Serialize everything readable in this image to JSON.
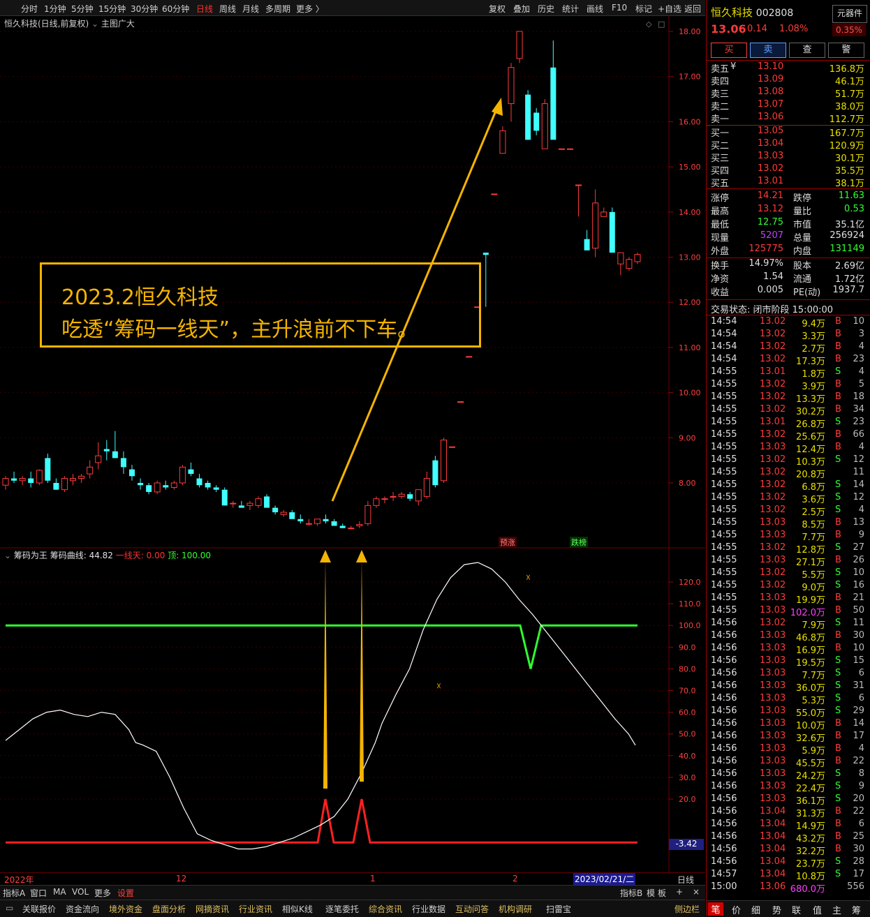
{
  "topbar": {
    "periods": [
      "分时",
      "1分钟",
      "5分钟",
      "15分钟",
      "30分钟",
      "60分钟",
      "日线",
      "周线",
      "月线",
      "多周期",
      "更多 〉"
    ],
    "active": "日线",
    "right_tools": [
      "复权",
      "叠加",
      "历史",
      "统计",
      "画线",
      "F10",
      "标记",
      "+自选",
      "返回"
    ]
  },
  "main_chart": {
    "title": "恒久科技(日线,前复权)",
    "indicator_name": "主图广大",
    "badges": [
      "预涨",
      "跌榜"
    ]
  },
  "annotation": {
    "line1": "2023.2恒久科技",
    "line2": "吃透“筹码一线天”，主升浪前不下车。"
  },
  "indicator": {
    "name": "筹码为王",
    "curve_label": "筹码曲线: 44.82",
    "line_label": "一线天: 0.00",
    "top_label": "顶: 100.00",
    "current_value": "-3.42"
  },
  "x_axis": {
    "labels": [
      "2022年",
      "12",
      "1",
      "2"
    ],
    "cursor_date": "2023/02/21/二",
    "period": "日线"
  },
  "bottom_tabs": {
    "row1": [
      "指标A",
      "窗口",
      "MA",
      "VOL",
      "更多",
      "设置"
    ],
    "row1_right": [
      "指标B",
      "模",
      "板",
      "+",
      "×"
    ],
    "row2": [
      "关联报价",
      "资金流向",
      "境外资金",
      "盘面分析",
      "网摘资讯",
      "行业资讯",
      "相似K线",
      "逐笔委托",
      "综合资讯",
      "行业数据",
      "互动问答",
      "机构调研",
      "扫雷宝"
    ],
    "sidebar": "侧边栏"
  },
  "chart_data": {
    "type": "candlestick",
    "price_axis": {
      "ticks": [
        8,
        9,
        10,
        11,
        12,
        13,
        14,
        15,
        16,
        17,
        18
      ],
      "unit_suffix": ".00"
    },
    "candles": [
      [
        7.95,
        8.15,
        7.85,
        8.1
      ],
      [
        8.1,
        8.25,
        8.0,
        8.05
      ],
      [
        8.05,
        8.15,
        7.95,
        8.1
      ],
      [
        8.1,
        8.25,
        7.9,
        8.0
      ],
      [
        8.0,
        8.3,
        7.95,
        8.28
      ],
      [
        8.55,
        8.65,
        8.0,
        8.05
      ],
      [
        8.0,
        8.1,
        7.85,
        7.85
      ],
      [
        7.85,
        8.15,
        7.8,
        8.1
      ],
      [
        8.05,
        8.2,
        7.95,
        8.1
      ],
      [
        8.1,
        8.2,
        8.0,
        8.15
      ],
      [
        8.2,
        8.5,
        8.1,
        8.35
      ],
      [
        8.45,
        8.9,
        8.3,
        8.6
      ],
      [
        8.75,
        8.95,
        8.5,
        8.7
      ],
      [
        8.7,
        9.15,
        8.6,
        8.55
      ],
      [
        8.55,
        8.7,
        8.2,
        8.35
      ],
      [
        8.3,
        8.4,
        8.05,
        8.15
      ],
      [
        8.0,
        8.1,
        7.85,
        7.95
      ],
      [
        7.95,
        8.0,
        7.75,
        7.8
      ],
      [
        7.8,
        8.05,
        7.75,
        8.0
      ],
      [
        7.95,
        8.05,
        7.85,
        7.9
      ],
      [
        7.9,
        8.05,
        7.85,
        8.0
      ],
      [
        8.0,
        8.4,
        7.95,
        8.35
      ],
      [
        8.3,
        8.45,
        8.15,
        8.2
      ],
      [
        8.1,
        8.2,
        7.9,
        7.95
      ],
      [
        8.0,
        8.05,
        7.85,
        7.9
      ],
      [
        7.9,
        7.95,
        7.8,
        7.85
      ],
      [
        7.85,
        7.9,
        7.5,
        7.5
      ],
      [
        7.55,
        7.6,
        7.45,
        7.55
      ],
      [
        7.5,
        7.6,
        7.45,
        7.45
      ],
      [
        7.5,
        7.6,
        7.4,
        7.55
      ],
      [
        7.5,
        7.7,
        7.45,
        7.65
      ],
      [
        7.7,
        7.75,
        7.45,
        7.45
      ],
      [
        7.45,
        7.5,
        7.3,
        7.35
      ],
      [
        7.3,
        7.4,
        7.25,
        7.35
      ],
      [
        7.35,
        7.4,
        7.2,
        7.2
      ],
      [
        7.2,
        7.3,
        7.1,
        7.15
      ],
      [
        7.1,
        7.2,
        7.05,
        7.1
      ],
      [
        7.1,
        7.2,
        7.05,
        7.2
      ],
      [
        7.2,
        7.3,
        7.1,
        7.15
      ],
      [
        7.15,
        7.2,
        7.05,
        7.05
      ],
      [
        7.05,
        7.1,
        7.0,
        7.0
      ],
      [
        7.0,
        7.05,
        6.98,
        7.0
      ],
      [
        7.05,
        7.15,
        7.0,
        7.08
      ],
      [
        7.1,
        7.6,
        7.05,
        7.5
      ],
      [
        7.5,
        7.7,
        7.45,
        7.65
      ],
      [
        7.65,
        7.7,
        7.55,
        7.65
      ],
      [
        7.7,
        7.8,
        7.6,
        7.7
      ],
      [
        7.7,
        7.8,
        7.65,
        7.75
      ],
      [
        7.75,
        7.8,
        7.6,
        7.65
      ],
      [
        7.6,
        7.85,
        7.5,
        7.85
      ],
      [
        7.7,
        8.25,
        7.65,
        8.1
      ],
      [
        8.5,
        8.6,
        7.9,
        7.95
      ],
      [
        8.05,
        9.0,
        8.0,
        8.95
      ],
      [
        8.8,
        8.8,
        8.8,
        8.8
      ],
      [
        9.8,
        9.8,
        9.8,
        9.8
      ],
      [
        10.8,
        10.8,
        10.8,
        10.8
      ],
      [
        11.9,
        11.9,
        11.9,
        11.9
      ],
      [
        13.1,
        13.1,
        11.9,
        13.05
      ],
      [
        14.4,
        14.4,
        14.4,
        14.4
      ],
      [
        15.3,
        15.9,
        15.3,
        15.8
      ],
      [
        16.4,
        17.3,
        16.0,
        17.2
      ],
      [
        17.4,
        18.0,
        17.3,
        18.0
      ],
      [
        16.6,
        16.7,
        15.6,
        15.6
      ],
      [
        16.2,
        16.3,
        15.7,
        15.8
      ],
      [
        15.4,
        16.5,
        15.4,
        16.4
      ],
      [
        17.2,
        17.8,
        15.7,
        15.6
      ],
      [
        15.4,
        15.4,
        15.4,
        15.4
      ],
      [
        15.4,
        15.4,
        15.4,
        15.4
      ],
      [
        14.6,
        14.6,
        13.9,
        14.6
      ],
      [
        13.4,
        13.6,
        13.2,
        13.15
      ],
      [
        13.2,
        14.5,
        13.0,
        14.2
      ],
      [
        13.9,
        14.1,
        13.9,
        14.0
      ],
      [
        14.0,
        14.1,
        13.1,
        13.1
      ],
      [
        12.85,
        13.1,
        12.6,
        13.1
      ],
      [
        12.75,
        13.0,
        12.7,
        12.95
      ],
      [
        12.9,
        13.1,
        12.85,
        13.06
      ]
    ],
    "indicator_axis": {
      "ticks": [
        20,
        30,
        40,
        50,
        60,
        70,
        80,
        90,
        100,
        110,
        120
      ]
    },
    "curve": [
      [
        0,
        47
      ],
      [
        4,
        52
      ],
      [
        8,
        57
      ],
      [
        12,
        60
      ],
      [
        16,
        61
      ],
      [
        20,
        59
      ],
      [
        24,
        58
      ],
      [
        28,
        60
      ],
      [
        32,
        59
      ],
      [
        36,
        52
      ],
      [
        38,
        46
      ],
      [
        40,
        45
      ],
      [
        44,
        42
      ],
      [
        48,
        30
      ],
      [
        52,
        16
      ],
      [
        56,
        4
      ],
      [
        60,
        1
      ],
      [
        64,
        -1
      ],
      [
        68,
        -3
      ],
      [
        72,
        -3
      ],
      [
        76,
        -2
      ],
      [
        80,
        0
      ],
      [
        84,
        2
      ],
      [
        88,
        5
      ],
      [
        92,
        8
      ],
      [
        96,
        12
      ],
      [
        100,
        20
      ],
      [
        104,
        32
      ],
      [
        108,
        46
      ],
      [
        110,
        55
      ],
      [
        114,
        68
      ],
      [
        118,
        80
      ],
      [
        122,
        98
      ],
      [
        126,
        112
      ],
      [
        130,
        122
      ],
      [
        134,
        128
      ],
      [
        138,
        129
      ],
      [
        142,
        126
      ],
      [
        146,
        120
      ],
      [
        150,
        112
      ],
      [
        154,
        105
      ],
      [
        158,
        97
      ],
      [
        162,
        89
      ],
      [
        166,
        81
      ],
      [
        170,
        73
      ],
      [
        174,
        65
      ],
      [
        178,
        57
      ],
      [
        182,
        50
      ],
      [
        184,
        44.82
      ]
    ],
    "yixiantian_spikes": [
      20,
      20
    ],
    "top_line": 100,
    "top_dip": 80
  }
}
